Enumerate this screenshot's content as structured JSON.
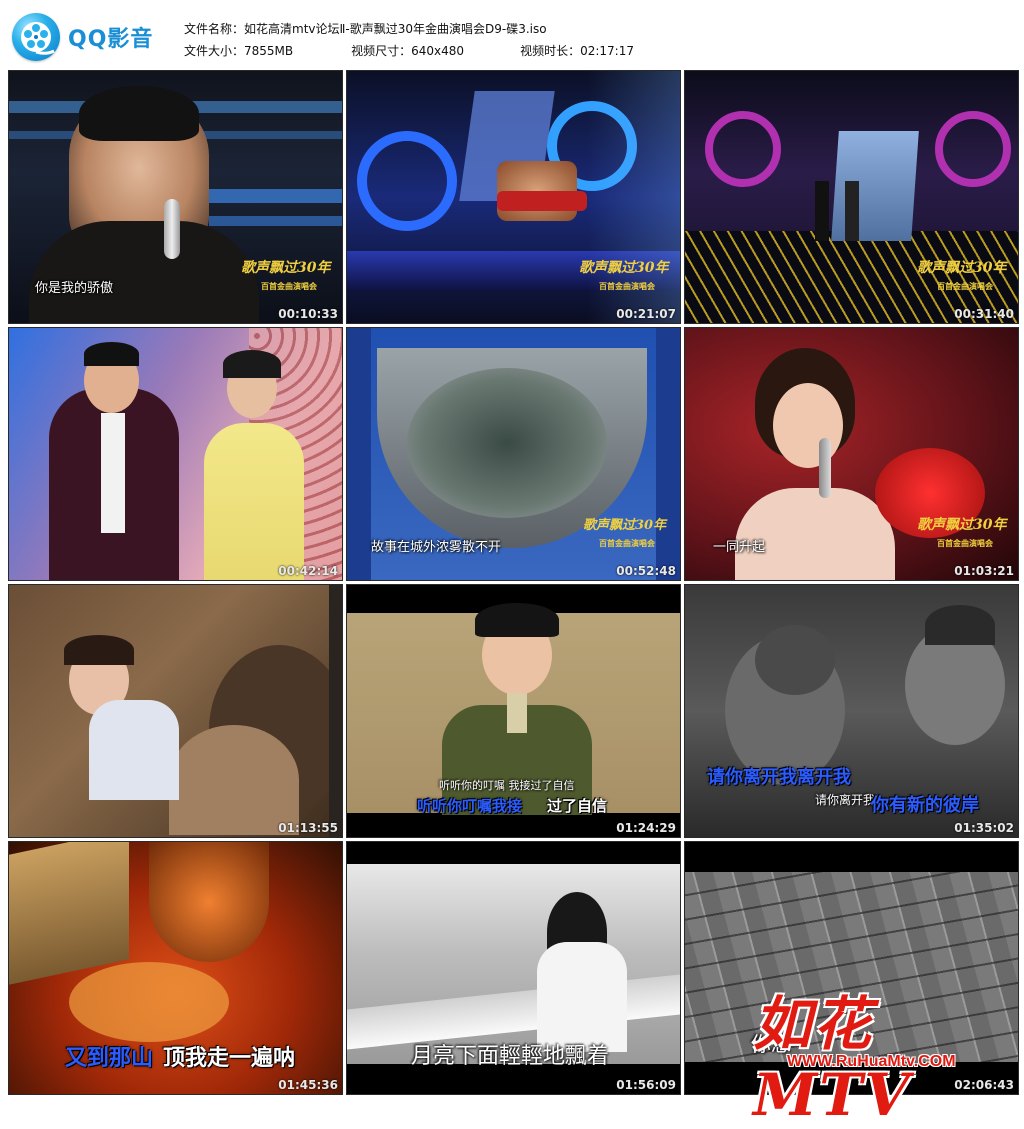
{
  "app": {
    "logo_text": "QQ影音",
    "logo_icon": "film-reel-icon"
  },
  "file_info": {
    "name_label": "文件名称：",
    "name_value": "如花高清mtv论坛Ⅱ-歌声飘过30年金曲演唱会D9-碟3.iso",
    "size_label": "文件大小：",
    "size_value": "7855MB",
    "dims_label": "视频尺寸：",
    "dims_value": "640x480",
    "duration_label": "视频时长：",
    "duration_value": "02:17:17"
  },
  "thumbnails": [
    {
      "timestamp": "00:10:33",
      "subtitle": "你是我的骄傲",
      "logo": "歌声飘过30年",
      "logo_sub": "百首金曲演唱会"
    },
    {
      "timestamp": "00:21:07",
      "logo": "歌声飘过30年",
      "logo_sub": "百首金曲演唱会"
    },
    {
      "timestamp": "00:31:40",
      "logo": "歌声飘过30年",
      "logo_sub": "百首金曲演唱会"
    },
    {
      "timestamp": "00:42:14"
    },
    {
      "timestamp": "00:52:48",
      "subtitle": "故事在城外浓雾散不开",
      "logo": "歌声飘过30年",
      "logo_sub": "百首金曲演唱会"
    },
    {
      "timestamp": "01:03:21",
      "subtitle": "一同升起",
      "logo": "歌声飘过30年",
      "logo_sub": "百首金曲演唱会"
    },
    {
      "timestamp": "01:13:55"
    },
    {
      "timestamp": "01:24:29",
      "subtitle": "听听你的叮嘱 我接过了自信",
      "karaoke_sung": "听听你叮嘱我接",
      "karaoke_rest": "过了自信"
    },
    {
      "timestamp": "01:35:02",
      "karaoke_line1": "请你离开我离开我",
      "subtitle": "请你离开我",
      "karaoke_line2": "你有新的彼岸"
    },
    {
      "timestamp": "01:45:36",
      "karaoke_sung": "又到那山",
      "karaoke_rest": "顶我走一遍呐"
    },
    {
      "timestamp": "01:56:09",
      "subtitle": "月亮下面輕輕地飄着"
    },
    {
      "timestamp": "02:06:43",
      "subtitle": "你想"
    }
  ],
  "watermark": {
    "text": "如花MTV",
    "url": "WWW.RuHuaMtv.COM"
  },
  "colors": {
    "accent": "#1a8fd6",
    "watermark": "#e11a12",
    "karaoke_blue": "#2b5cff"
  }
}
